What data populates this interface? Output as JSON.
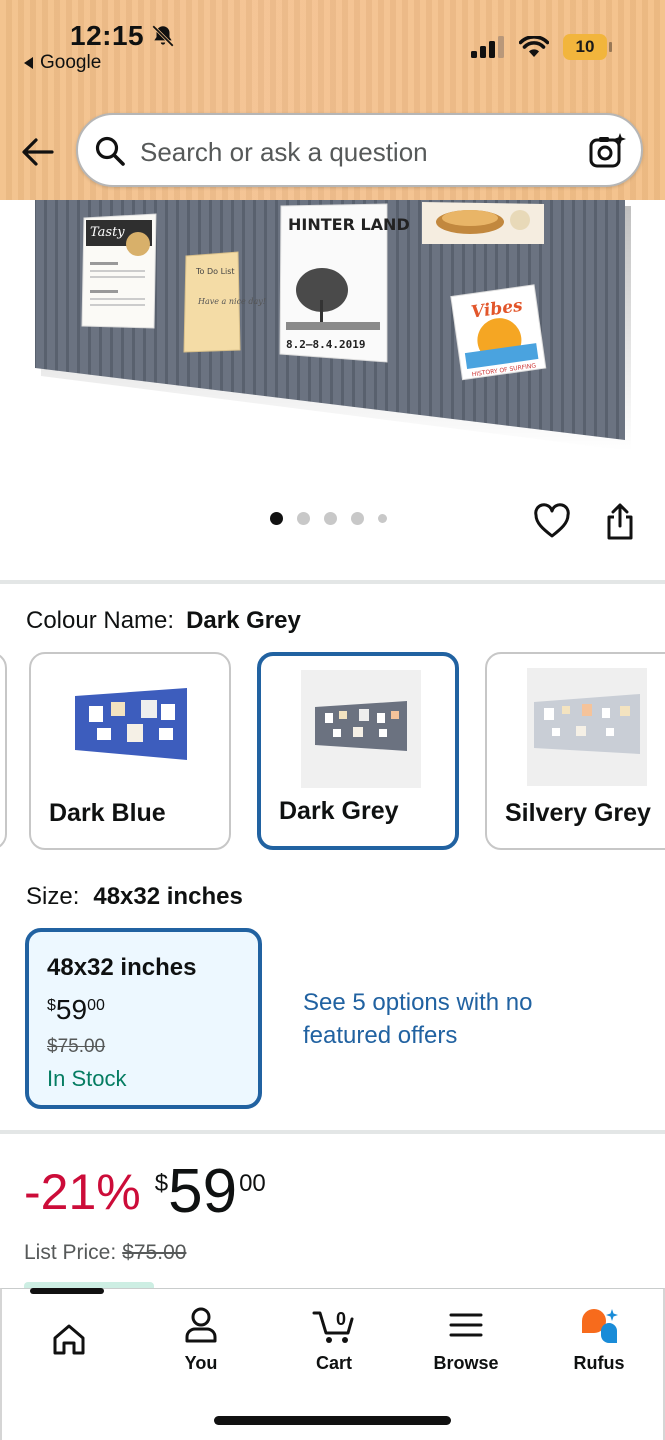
{
  "status_bar": {
    "time": "12:15",
    "back_app": "Google",
    "battery": "10"
  },
  "search": {
    "placeholder": "Search or ask a question"
  },
  "product_image": {
    "poster_title": "HINTER LAND",
    "poster_dates": "8.2–8.4.2019",
    "menu_card_title": "Tasty",
    "note_title": "To Do List",
    "note_text": "Have a nice day!",
    "postcard_title": "Vibes",
    "postcard_caption": "HISTORY OF SURFING"
  },
  "carousel": {
    "dot_count": 5,
    "active_index": 0
  },
  "colour": {
    "label": "Colour Name:",
    "selected": "Dark Grey",
    "options": [
      {
        "name": "Dark Blue",
        "swatch": "#3b5bb5"
      },
      {
        "name": "Dark Grey",
        "swatch": "#6b7280"
      },
      {
        "name": "Silvery Grey",
        "swatch": "#c9ced6"
      }
    ]
  },
  "size": {
    "label": "Size:",
    "selected": "48x32 inches",
    "card": {
      "title": "48x32 inches",
      "currency": "$",
      "price_whole": "59",
      "price_fraction": "00",
      "list_price": "$75.00",
      "stock": "In Stock"
    },
    "options_link": "See 5 options with no featured offers"
  },
  "price": {
    "discount": "-21%",
    "currency": "$",
    "whole": "59",
    "fraction": "00",
    "list_label": "List Price:",
    "list_value": "$75.00"
  },
  "bottom_nav": {
    "items": [
      {
        "label": ""
      },
      {
        "label": "You"
      },
      {
        "label": "Cart"
      },
      {
        "label": "Browse"
      },
      {
        "label": "Rufus"
      }
    ],
    "cart_count": "0"
  },
  "colors": {
    "header_bg": "#f3c08a",
    "link_blue": "#2162a1",
    "deal_red": "#cc0c39",
    "stock_green": "#067d62",
    "rufus_orange": "#f76b1c",
    "rufus_blue": "#1a8cd8"
  }
}
